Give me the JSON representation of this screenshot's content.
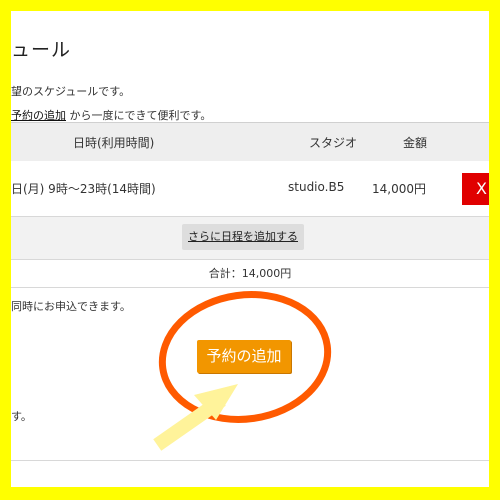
{
  "page": {
    "title": "ュール",
    "note_line1": "望のスケジュールです。",
    "note_link": "予約の追加",
    "note_line2_rest": "から一度にできて便利です。",
    "simultaneous_note": "同時にお申込できます。",
    "bottom_text": "す。"
  },
  "table": {
    "headers": {
      "datetime": "日時(利用時間)",
      "studio": "スタジオ",
      "price": "金額"
    },
    "rows": [
      {
        "datetime": "日(月) 9時～23時(14時間)",
        "studio": "studio.B5",
        "price": "14,000円",
        "delete_label": "X"
      }
    ],
    "add_schedule_label": "さらに日程を追加する",
    "total": "合計：14,000円"
  },
  "cta": {
    "reserve_label": "予約の追加"
  },
  "colors": {
    "border": "#ffff00",
    "reserve_button": "#f29600",
    "delete_button": "#e00000",
    "highlight_circle": "#ff5a00",
    "arrow": "#fff39a"
  }
}
